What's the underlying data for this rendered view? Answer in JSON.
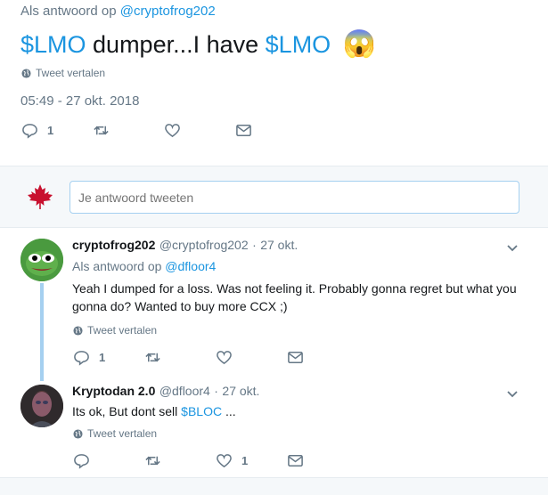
{
  "main_tweet": {
    "reply_prefix": "Als antwoord op",
    "reply_to": "@cryptofrog202",
    "text_cashtag1": "$LMO",
    "text_middle": " dumper...I have ",
    "text_cashtag2": "$LMO",
    "emoji": "😱",
    "translate": "Tweet vertalen",
    "timestamp": "05:49 - 27 okt. 2018",
    "reply_count": "1"
  },
  "reply_box": {
    "placeholder": "Je antwoord tweeten"
  },
  "replies": [
    {
      "name": "cryptofrog202",
      "handle": "@cryptofrog202",
      "sep": "·",
      "date": "27 okt.",
      "reply_prefix": "Als antwoord op",
      "reply_to": "@dfloor4",
      "text": "Yeah I dumped for a loss. Was not feeling it. Probably gonna regret but what you gonna do? Wanted to buy more CCX ;)",
      "translate": "Tweet vertalen",
      "reply_count": "1"
    },
    {
      "name": "Kryptodan 2.0",
      "handle": "@dfloor4",
      "sep": "·",
      "date": "27 okt.",
      "text_prefix": "Its ok, But dont sell ",
      "cashtag": "$BLOC",
      "text_suffix": " ...",
      "translate": "Tweet vertalen",
      "like_count": "1"
    }
  ],
  "colors": {
    "link": "#1b95e0",
    "grey": "#657786",
    "thread_line": "#a5d0f0"
  }
}
